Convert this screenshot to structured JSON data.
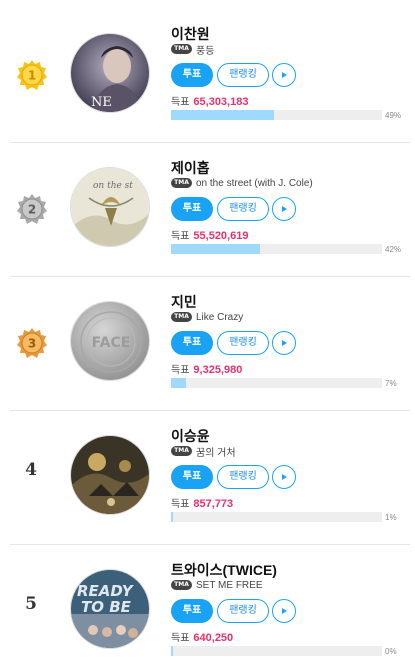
{
  "accent_color": "#1aa3f5",
  "vote_count_color": "#e8316c",
  "ranking": [
    {
      "rank": "1",
      "medal": "gold",
      "artist": "이찬원",
      "badge": "TMA",
      "song": "풍등",
      "vote_label": "투표",
      "fan_ranking_label": "팬랭킹",
      "play_icon": "play-icon",
      "votes_label": "득표",
      "votes": "65,303,183",
      "percent": "49%",
      "percent_value": 49
    },
    {
      "rank": "2",
      "medal": "silver",
      "artist": "제이홉",
      "badge": "TMA",
      "song": "on the street (with J. Cole)",
      "vote_label": "투표",
      "fan_ranking_label": "팬랭킹",
      "play_icon": "play-icon",
      "votes_label": "득표",
      "votes": "55,520,619",
      "percent": "42%",
      "percent_value": 42
    },
    {
      "rank": "3",
      "medal": "bronze",
      "artist": "지민",
      "badge": "TMA",
      "song": "Like Crazy",
      "vote_label": "투표",
      "fan_ranking_label": "팬랭킹",
      "play_icon": "play-icon",
      "votes_label": "득표",
      "votes": "9,325,980",
      "percent": "7%",
      "percent_value": 7
    },
    {
      "rank": "4",
      "medal": "",
      "artist": "이승윤",
      "badge": "TMA",
      "song": "꿈의 거처",
      "vote_label": "투표",
      "fan_ranking_label": "팬랭킹",
      "play_icon": "play-icon",
      "votes_label": "득표",
      "votes": "857,773",
      "percent": "1%",
      "percent_value": 1
    },
    {
      "rank": "5",
      "medal": "",
      "artist": "트와이스(TWICE)",
      "badge": "TMA",
      "song": "SET ME FREE",
      "vote_label": "투표",
      "fan_ranking_label": "팬랭킹",
      "play_icon": "play-icon",
      "votes_label": "득표",
      "votes": "640,250",
      "percent": "0%",
      "percent_value": 0
    }
  ]
}
